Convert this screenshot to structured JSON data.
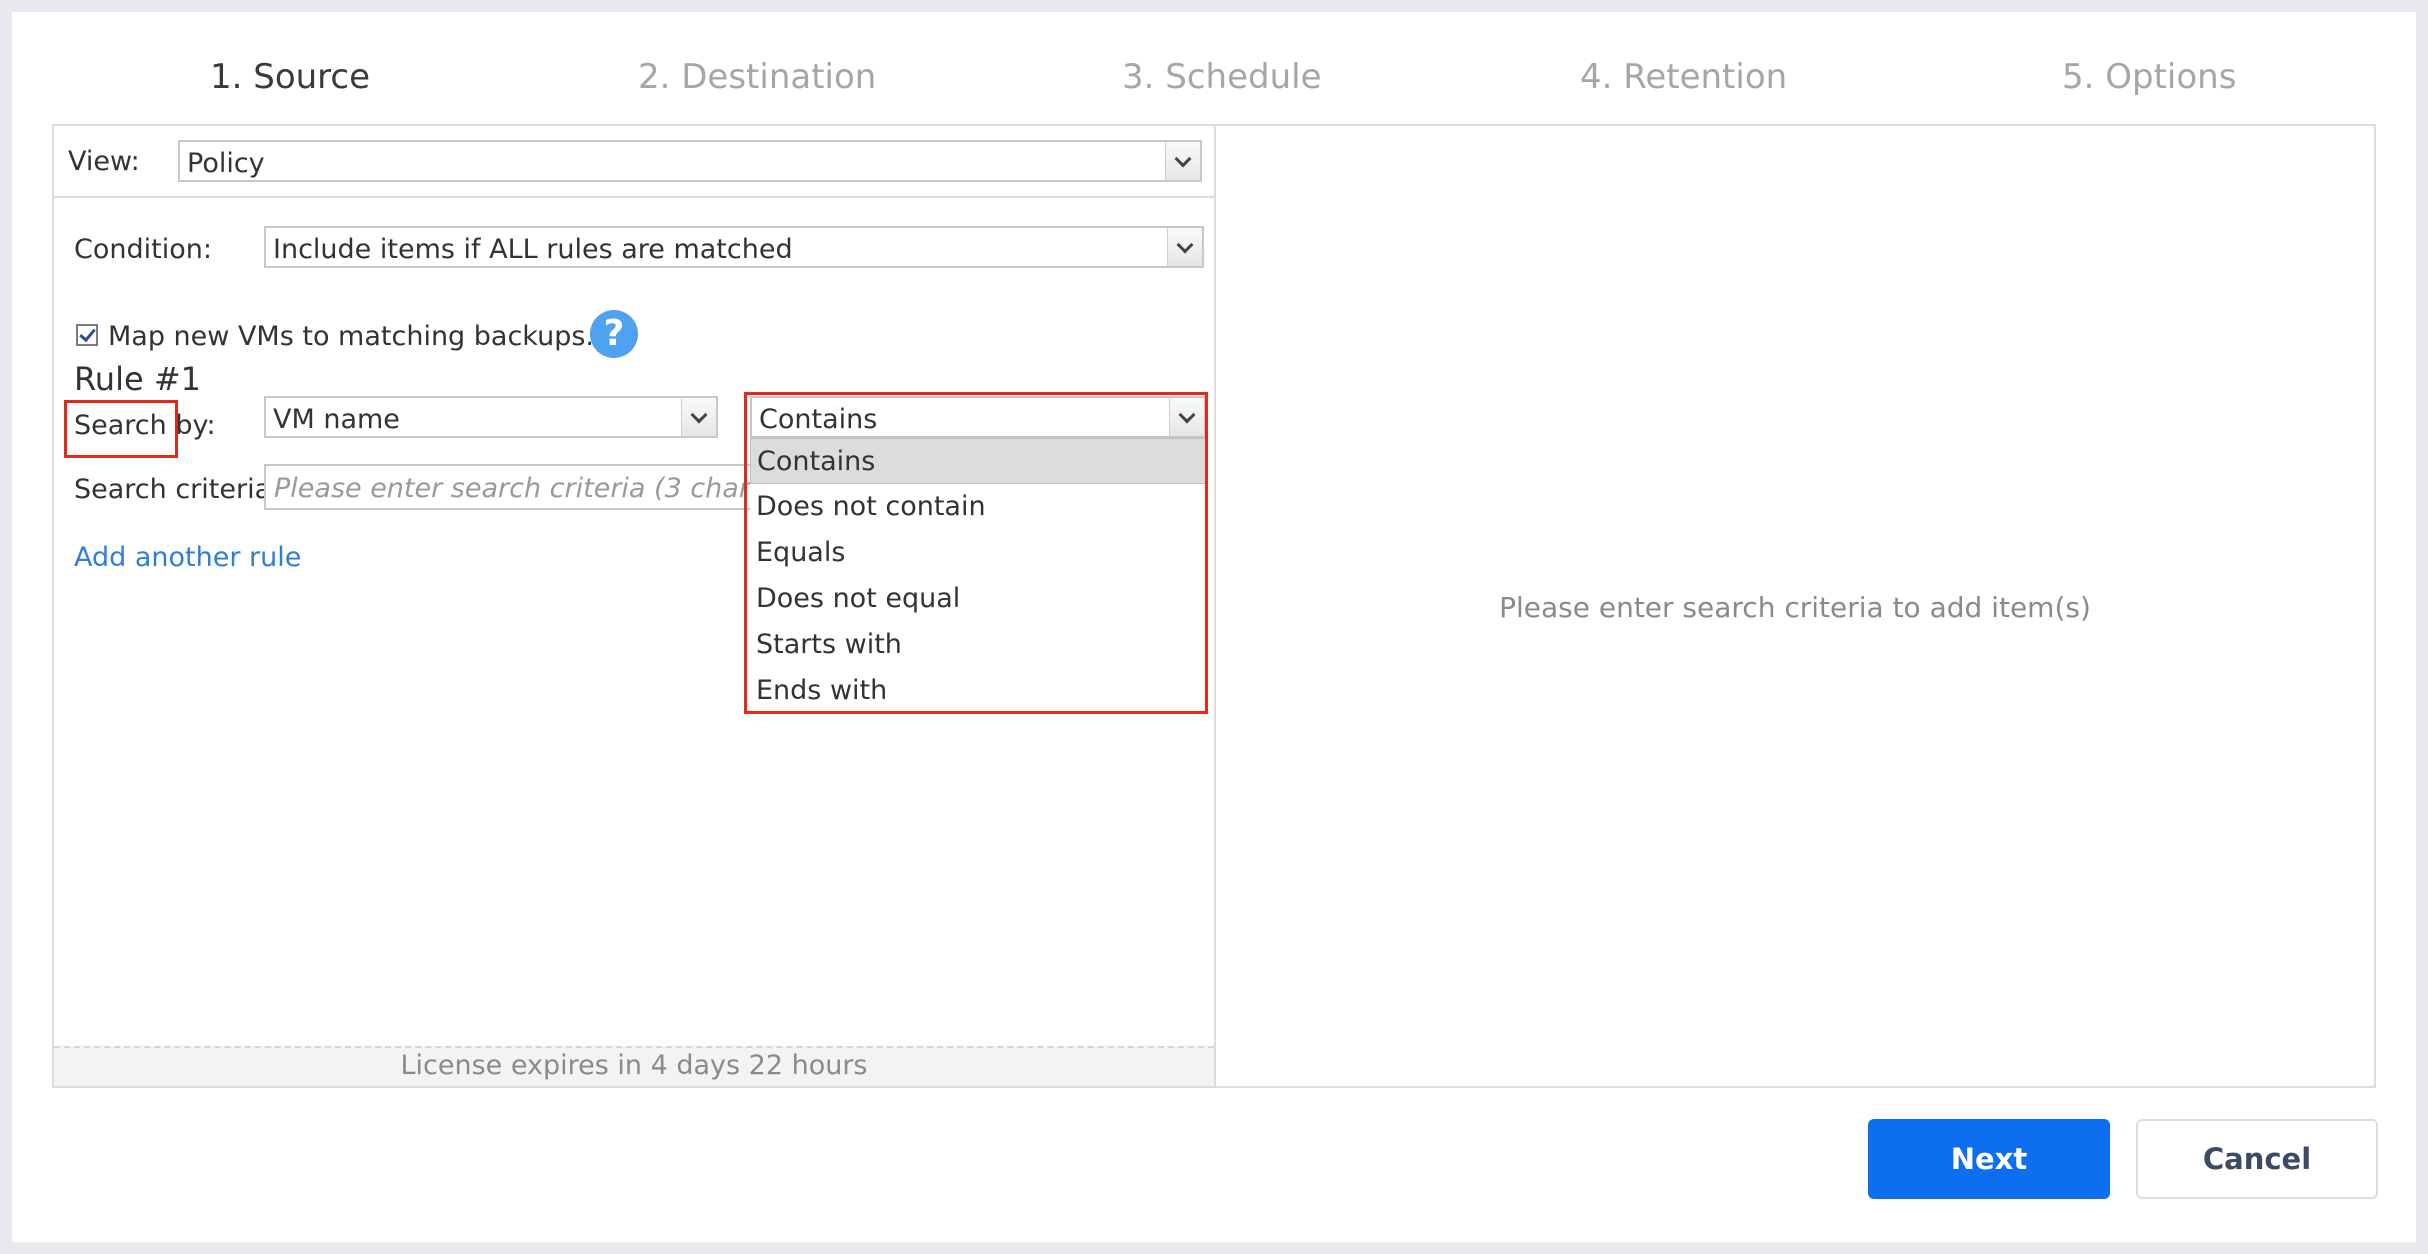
{
  "steps": [
    {
      "label": "1. Source"
    },
    {
      "label": "2. Destination"
    },
    {
      "label": "3. Schedule"
    },
    {
      "label": "4. Retention"
    },
    {
      "label": "5. Options"
    }
  ],
  "view": {
    "label": "View:",
    "value": "Policy"
  },
  "condition": {
    "label": "Condition:",
    "value": "Include items if ALL rules are matched"
  },
  "map_vms": {
    "label": "Map new VMs to matching backups.",
    "checked": true
  },
  "help_icon": "?",
  "rule": {
    "title": "Rule #1",
    "search_by_label": "Search by:",
    "search_by_value": "VM name",
    "operator_value": "Contains",
    "operator_options": [
      "Contains",
      "Does not contain",
      "Equals",
      "Does not equal",
      "Starts with",
      "Ends with"
    ],
    "criteria_label": "Search criteria:",
    "criteria_placeholder": "Please enter search criteria (3 characters minimum)"
  },
  "add_rule_link": "Add another rule",
  "license_text": "License expires in 4 days 22 hours",
  "right_panel_message": "Please enter search criteria to add item(s)",
  "buttons": {
    "next": "Next",
    "cancel": "Cancel"
  },
  "colors": {
    "highlight": "#e8261c",
    "primary": "#0d6ef0",
    "link": "#2f7fd6"
  }
}
